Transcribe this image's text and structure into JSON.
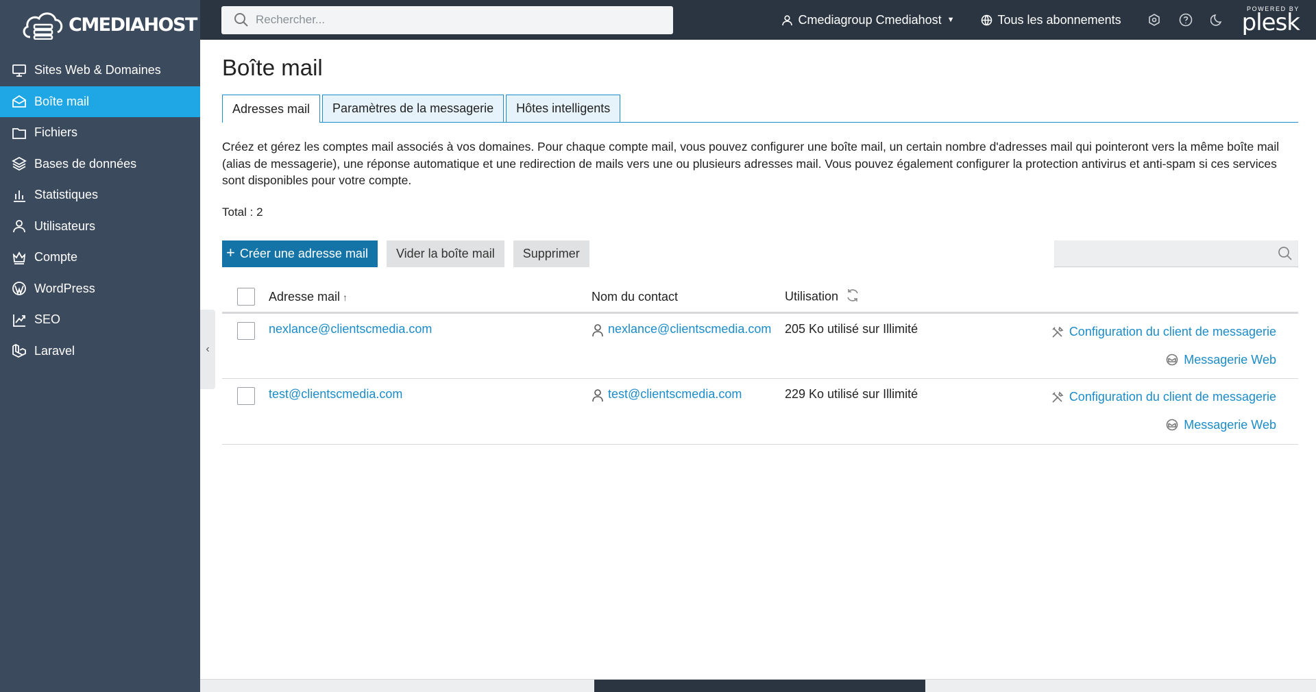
{
  "brand": {
    "logo_text": "CMEDIAHOST",
    "powered_by": "POWERED BY",
    "plesk": "plesk"
  },
  "sidebar": {
    "items": [
      {
        "label": "Sites Web & Domaines",
        "icon": "monitor-icon"
      },
      {
        "label": "Boîte mail",
        "icon": "mail-icon",
        "active": true
      },
      {
        "label": "Fichiers",
        "icon": "folder-icon"
      },
      {
        "label": "Bases de données",
        "icon": "layers-icon"
      },
      {
        "label": "Statistiques",
        "icon": "bar-chart-icon"
      },
      {
        "label": "Utilisateurs",
        "icon": "user-icon"
      },
      {
        "label": "Compte",
        "icon": "crown-icon"
      },
      {
        "label": "WordPress",
        "icon": "wordpress-icon"
      },
      {
        "label": "SEO",
        "icon": "trend-icon"
      },
      {
        "label": "Laravel",
        "icon": "laravel-icon"
      }
    ]
  },
  "topbar": {
    "search_placeholder": "Rechercher...",
    "user_label": "Cmediagroup Cmediahost",
    "subscriptions_label": "Tous les abonnements"
  },
  "main": {
    "title": "Boîte mail",
    "tabs": [
      {
        "label": "Adresses mail",
        "active": true
      },
      {
        "label": "Paramètres de la messagerie"
      },
      {
        "label": "Hôtes intelligents"
      }
    ],
    "description": "Créez et gérez les comptes mail associés à vos domaines. Pour chaque compte mail, vous pouvez configurer une boîte mail, un certain nombre d'adresses mail qui pointeront vers la même boîte mail (alias de messagerie), une réponse automatique et une redirection de mails vers une ou plusieurs adresses mail. Vous pouvez également configurer la protection antivirus et anti-spam si ces services sont disponibles pour votre compte.",
    "total": "Total : 2",
    "toolbar": {
      "create_label": "Créer une adresse mail",
      "empty_label": "Vider la boîte mail",
      "delete_label": "Supprimer"
    },
    "table": {
      "headers": {
        "mail": "Adresse mail",
        "contact": "Nom du contact",
        "usage": "Utilisation"
      },
      "rows": [
        {
          "mail": "nexlance@clientscmedia.com",
          "contact": "nexlance@clientscmedia.com",
          "usage": "205 Ko utilisé sur Illimité",
          "action_config": "Configuration du client de messagerie",
          "action_webmail": "Messagerie Web"
        },
        {
          "mail": "test@clientscmedia.com",
          "contact": "test@clientscmedia.com",
          "usage": "229 Ko utilisé sur Illimité",
          "action_config": "Configuration du client de messagerie",
          "action_webmail": "Messagerie Web"
        }
      ]
    }
  },
  "colors": {
    "sidebar_bg": "#3b4a5c",
    "active": "#1ea7e4",
    "topbar_bg": "#2b3541",
    "link": "#1b8cc9",
    "primary_btn": "#1474a8"
  }
}
